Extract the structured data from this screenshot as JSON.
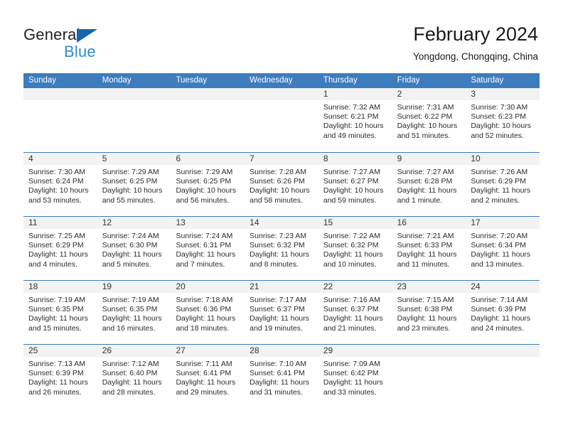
{
  "brand": {
    "name_part1": "General",
    "name_part2": "Blue",
    "triangle_color": "#1565a8",
    "blue_color": "#2e8ad1"
  },
  "header": {
    "title": "February 2024",
    "subtitle": "Yongdong, Chongqing, China"
  },
  "theme": {
    "header_blue": "#3d7cbd",
    "daynum_band": "#f2f2f2",
    "text": "#2b2b2b"
  },
  "weekdays": [
    "Sunday",
    "Monday",
    "Tuesday",
    "Wednesday",
    "Thursday",
    "Friday",
    "Saturday"
  ],
  "weeks": [
    [
      {
        "day": "",
        "sunrise": "",
        "sunset": "",
        "daylight1": "",
        "daylight2": ""
      },
      {
        "day": "",
        "sunrise": "",
        "sunset": "",
        "daylight1": "",
        "daylight2": ""
      },
      {
        "day": "",
        "sunrise": "",
        "sunset": "",
        "daylight1": "",
        "daylight2": ""
      },
      {
        "day": "",
        "sunrise": "",
        "sunset": "",
        "daylight1": "",
        "daylight2": ""
      },
      {
        "day": "1",
        "sunrise": "Sunrise: 7:32 AM",
        "sunset": "Sunset: 6:21 PM",
        "daylight1": "Daylight: 10 hours",
        "daylight2": "and 49 minutes."
      },
      {
        "day": "2",
        "sunrise": "Sunrise: 7:31 AM",
        "sunset": "Sunset: 6:22 PM",
        "daylight1": "Daylight: 10 hours",
        "daylight2": "and 51 minutes."
      },
      {
        "day": "3",
        "sunrise": "Sunrise: 7:30 AM",
        "sunset": "Sunset: 6:23 PM",
        "daylight1": "Daylight: 10 hours",
        "daylight2": "and 52 minutes."
      }
    ],
    [
      {
        "day": "4",
        "sunrise": "Sunrise: 7:30 AM",
        "sunset": "Sunset: 6:24 PM",
        "daylight1": "Daylight: 10 hours",
        "daylight2": "and 53 minutes."
      },
      {
        "day": "5",
        "sunrise": "Sunrise: 7:29 AM",
        "sunset": "Sunset: 6:25 PM",
        "daylight1": "Daylight: 10 hours",
        "daylight2": "and 55 minutes."
      },
      {
        "day": "6",
        "sunrise": "Sunrise: 7:29 AM",
        "sunset": "Sunset: 6:25 PM",
        "daylight1": "Daylight: 10 hours",
        "daylight2": "and 56 minutes."
      },
      {
        "day": "7",
        "sunrise": "Sunrise: 7:28 AM",
        "sunset": "Sunset: 6:26 PM",
        "daylight1": "Daylight: 10 hours",
        "daylight2": "and 58 minutes."
      },
      {
        "day": "8",
        "sunrise": "Sunrise: 7:27 AM",
        "sunset": "Sunset: 6:27 PM",
        "daylight1": "Daylight: 10 hours",
        "daylight2": "and 59 minutes."
      },
      {
        "day": "9",
        "sunrise": "Sunrise: 7:27 AM",
        "sunset": "Sunset: 6:28 PM",
        "daylight1": "Daylight: 11 hours",
        "daylight2": "and 1 minute."
      },
      {
        "day": "10",
        "sunrise": "Sunrise: 7:26 AM",
        "sunset": "Sunset: 6:29 PM",
        "daylight1": "Daylight: 11 hours",
        "daylight2": "and 2 minutes."
      }
    ],
    [
      {
        "day": "11",
        "sunrise": "Sunrise: 7:25 AM",
        "sunset": "Sunset: 6:29 PM",
        "daylight1": "Daylight: 11 hours",
        "daylight2": "and 4 minutes."
      },
      {
        "day": "12",
        "sunrise": "Sunrise: 7:24 AM",
        "sunset": "Sunset: 6:30 PM",
        "daylight1": "Daylight: 11 hours",
        "daylight2": "and 5 minutes."
      },
      {
        "day": "13",
        "sunrise": "Sunrise: 7:24 AM",
        "sunset": "Sunset: 6:31 PM",
        "daylight1": "Daylight: 11 hours",
        "daylight2": "and 7 minutes."
      },
      {
        "day": "14",
        "sunrise": "Sunrise: 7:23 AM",
        "sunset": "Sunset: 6:32 PM",
        "daylight1": "Daylight: 11 hours",
        "daylight2": "and 8 minutes."
      },
      {
        "day": "15",
        "sunrise": "Sunrise: 7:22 AM",
        "sunset": "Sunset: 6:32 PM",
        "daylight1": "Daylight: 11 hours",
        "daylight2": "and 10 minutes."
      },
      {
        "day": "16",
        "sunrise": "Sunrise: 7:21 AM",
        "sunset": "Sunset: 6:33 PM",
        "daylight1": "Daylight: 11 hours",
        "daylight2": "and 11 minutes."
      },
      {
        "day": "17",
        "sunrise": "Sunrise: 7:20 AM",
        "sunset": "Sunset: 6:34 PM",
        "daylight1": "Daylight: 11 hours",
        "daylight2": "and 13 minutes."
      }
    ],
    [
      {
        "day": "18",
        "sunrise": "Sunrise: 7:19 AM",
        "sunset": "Sunset: 6:35 PM",
        "daylight1": "Daylight: 11 hours",
        "daylight2": "and 15 minutes."
      },
      {
        "day": "19",
        "sunrise": "Sunrise: 7:19 AM",
        "sunset": "Sunset: 6:35 PM",
        "daylight1": "Daylight: 11 hours",
        "daylight2": "and 16 minutes."
      },
      {
        "day": "20",
        "sunrise": "Sunrise: 7:18 AM",
        "sunset": "Sunset: 6:36 PM",
        "daylight1": "Daylight: 11 hours",
        "daylight2": "and 18 minutes."
      },
      {
        "day": "21",
        "sunrise": "Sunrise: 7:17 AM",
        "sunset": "Sunset: 6:37 PM",
        "daylight1": "Daylight: 11 hours",
        "daylight2": "and 19 minutes."
      },
      {
        "day": "22",
        "sunrise": "Sunrise: 7:16 AM",
        "sunset": "Sunset: 6:37 PM",
        "daylight1": "Daylight: 11 hours",
        "daylight2": "and 21 minutes."
      },
      {
        "day": "23",
        "sunrise": "Sunrise: 7:15 AM",
        "sunset": "Sunset: 6:38 PM",
        "daylight1": "Daylight: 11 hours",
        "daylight2": "and 23 minutes."
      },
      {
        "day": "24",
        "sunrise": "Sunrise: 7:14 AM",
        "sunset": "Sunset: 6:39 PM",
        "daylight1": "Daylight: 11 hours",
        "daylight2": "and 24 minutes."
      }
    ],
    [
      {
        "day": "25",
        "sunrise": "Sunrise: 7:13 AM",
        "sunset": "Sunset: 6:39 PM",
        "daylight1": "Daylight: 11 hours",
        "daylight2": "and 26 minutes."
      },
      {
        "day": "26",
        "sunrise": "Sunrise: 7:12 AM",
        "sunset": "Sunset: 6:40 PM",
        "daylight1": "Daylight: 11 hours",
        "daylight2": "and 28 minutes."
      },
      {
        "day": "27",
        "sunrise": "Sunrise: 7:11 AM",
        "sunset": "Sunset: 6:41 PM",
        "daylight1": "Daylight: 11 hours",
        "daylight2": "and 29 minutes."
      },
      {
        "day": "28",
        "sunrise": "Sunrise: 7:10 AM",
        "sunset": "Sunset: 6:41 PM",
        "daylight1": "Daylight: 11 hours",
        "daylight2": "and 31 minutes."
      },
      {
        "day": "29",
        "sunrise": "Sunrise: 7:09 AM",
        "sunset": "Sunset: 6:42 PM",
        "daylight1": "Daylight: 11 hours",
        "daylight2": "and 33 minutes."
      },
      {
        "day": "",
        "sunrise": "",
        "sunset": "",
        "daylight1": "",
        "daylight2": ""
      },
      {
        "day": "",
        "sunrise": "",
        "sunset": "",
        "daylight1": "",
        "daylight2": ""
      }
    ]
  ]
}
